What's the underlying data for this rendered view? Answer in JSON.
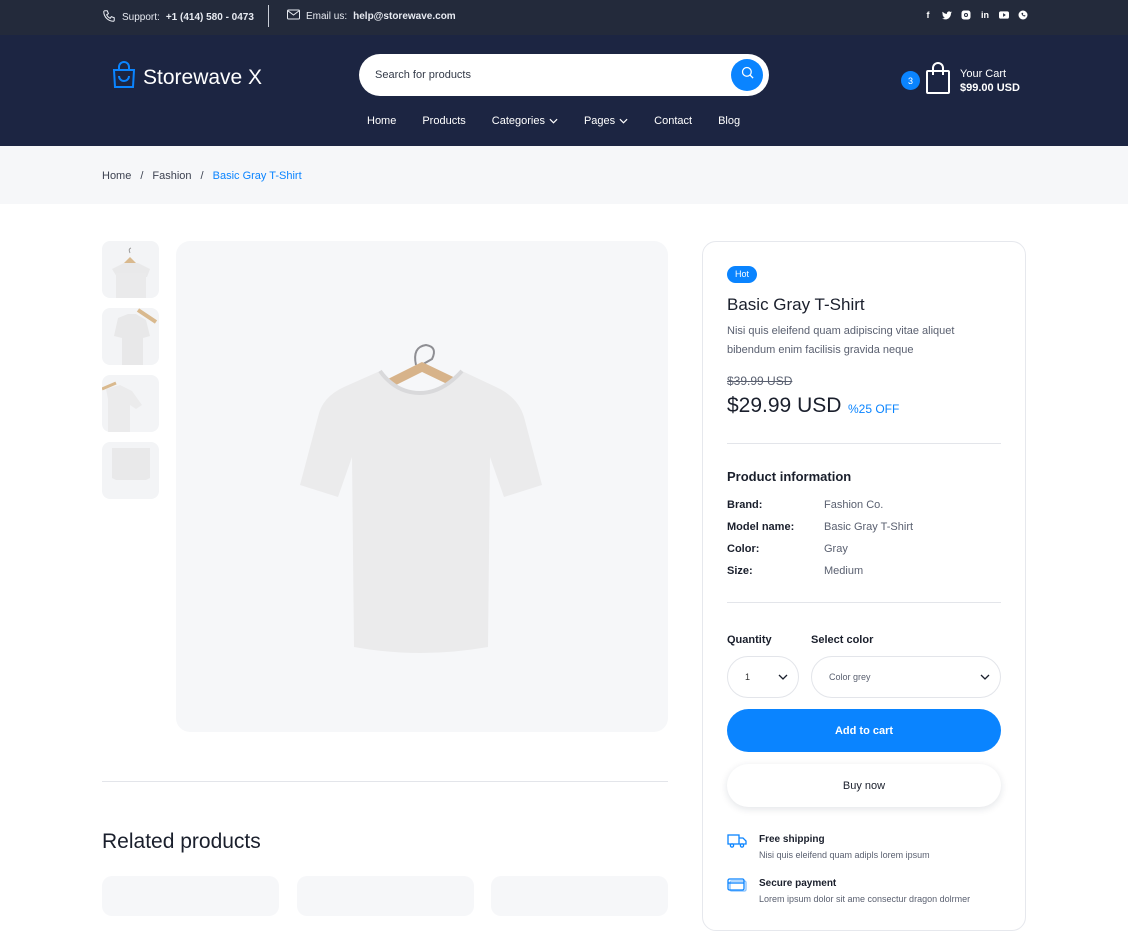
{
  "topbar": {
    "support_label": "Support:",
    "support_phone": "+1 (414) 580 - 0473",
    "email_label": "Email us:",
    "email_value": "help@storewave.com",
    "social": [
      "facebook-icon",
      "twitter-icon",
      "instagram-icon",
      "linkedin-icon",
      "youtube-icon",
      "whatsapp-icon"
    ]
  },
  "header": {
    "logo_text": "Storewave X",
    "search_placeholder": "Search for products",
    "cart": {
      "count": "3",
      "label": "Your Cart",
      "total": "$99.00 USD"
    },
    "nav": [
      {
        "label": "Home",
        "dropdown": false
      },
      {
        "label": "Products",
        "dropdown": false
      },
      {
        "label": "Categories",
        "dropdown": true
      },
      {
        "label": "Pages",
        "dropdown": true
      },
      {
        "label": "Contact",
        "dropdown": false
      },
      {
        "label": "Blog",
        "dropdown": false
      }
    ]
  },
  "breadcrumb": [
    "Home",
    "Fashion",
    "Basic Gray T-Shirt"
  ],
  "breadcrumb_sep": "/",
  "product": {
    "badge": "Hot",
    "title": "Basic Gray T-Shirt",
    "description": "Nisi quis eleifend quam adipiscing vitae aliquet bibendum enim facilisis gravida neque",
    "old_price": "$39.99 USD",
    "price": "$29.99 USD",
    "discount": "%25 OFF",
    "info_title": "Product information",
    "info": [
      {
        "key": "Brand:",
        "value": "Fashion Co."
      },
      {
        "key": "Model name:",
        "value": "Basic Gray T-Shirt"
      },
      {
        "key": "Color:",
        "value": "Gray"
      },
      {
        "key": "Size:",
        "value": "Medium"
      }
    ],
    "quantity_label": "Quantity",
    "quantity_value": "1",
    "color_label": "Select color",
    "color_value": "Color grey",
    "add_to_cart": "Add to cart",
    "buy_now": "Buy now",
    "features": [
      {
        "icon": "truck-icon",
        "title": "Free shipping",
        "desc": "Nisi quis eleifend quam adipls lorem ipsum"
      },
      {
        "icon": "card-icon",
        "title": "Secure payment",
        "desc": "Lorem ipsum dolor sit ame consectur dragon dolrmer"
      }
    ]
  },
  "related_title": "Related products",
  "colors": {
    "accent": "#0a84ff",
    "header": "#1c2542",
    "topbar": "#232a3b"
  }
}
